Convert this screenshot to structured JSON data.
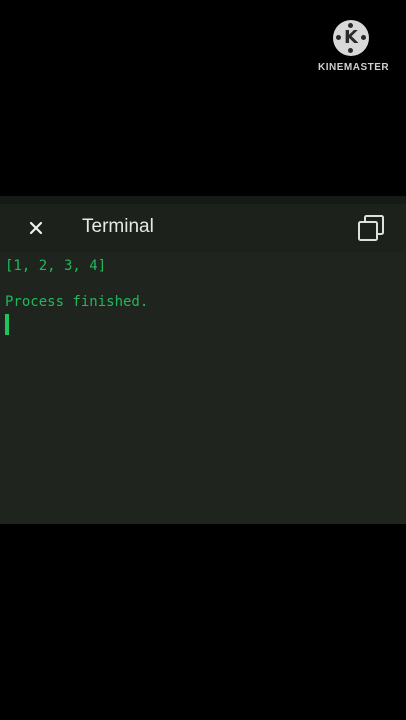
{
  "watermark": {
    "text": "KINEMASTER",
    "icon": "kinemaster-logo-icon"
  },
  "terminal": {
    "title": "Terminal",
    "close_icon": "close-icon",
    "copy_icon": "copy-icon",
    "output": [
      "[1, 2, 3, 4]",
      "Process finished."
    ]
  },
  "colors": {
    "background": "#000000",
    "terminal_bg": "#1f241f",
    "header_bg": "#1c211c",
    "output_text": "#22b85a",
    "title_text": "#e8e8e8"
  }
}
